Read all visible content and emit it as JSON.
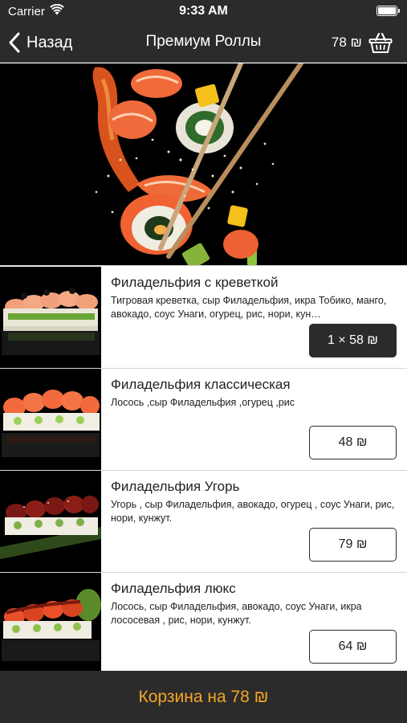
{
  "status_bar": {
    "carrier": "Carrier",
    "time": "9:33 AM"
  },
  "nav": {
    "back_label": "Назад",
    "title": "Премиум Роллы",
    "cart_total": "78 ₪",
    "cart_icon": "basket-icon"
  },
  "colors": {
    "bar_background": "#2b2b2b",
    "accent": "#f5a623",
    "text": "#222222"
  },
  "products": [
    {
      "name": "Филадельфия с креветкой",
      "description": "Тигровая  креветка, сыр Филадельфия, икра Тобико, манго, авокадо, соус Унаги, огурец, рис, нори, кун…",
      "price_label": "1 × 58 ₪",
      "selected": true
    },
    {
      "name": "Филадельфия классическая",
      "description": "Лосось ,сыр Филадельфия ,огурец ,рис",
      "price_label": "48 ₪",
      "selected": false
    },
    {
      "name": "Филадельфия Угорь",
      "description": "Угорь , сыр Филадельфия, авокадо, огурец , соус Унаги, рис, нори, кунжут.",
      "price_label": "79 ₪",
      "selected": false
    },
    {
      "name": "Филадельфия люкс",
      "description": "Лосось, сыр Филадельфия, авокадо, соус Унаги, икра лососевая , рис, нори, кунжут.",
      "price_label": "64 ₪",
      "selected": false
    }
  ],
  "footer": {
    "cart_button_label": "Корзина на 78 ₪"
  }
}
